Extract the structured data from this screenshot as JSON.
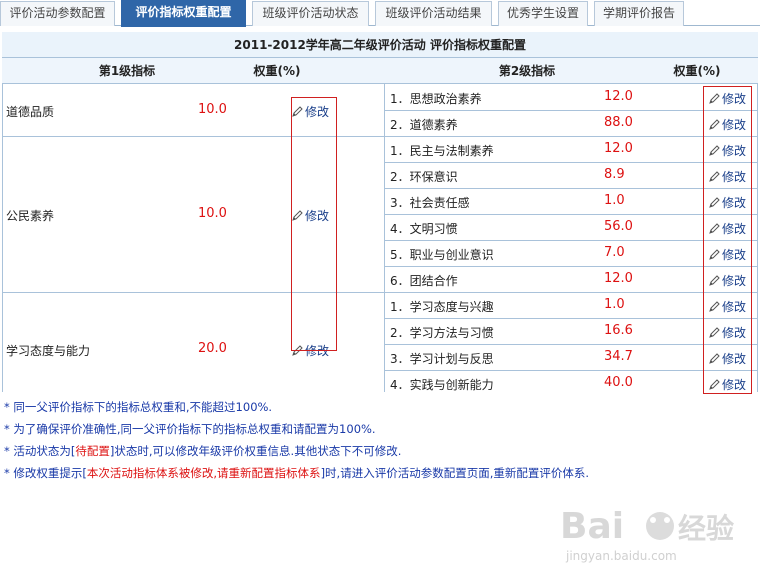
{
  "tabs": [
    {
      "label": "评价活动参数配置",
      "active": false
    },
    {
      "label": "评价指标权重配置",
      "active": true
    },
    {
      "label": "班级评价活动状态",
      "active": false
    },
    {
      "label": "班级评价活动结果",
      "active": false
    },
    {
      "label": "优秀学生设置",
      "active": false
    },
    {
      "label": "学期评价报告",
      "active": false
    }
  ],
  "table": {
    "title": "2011-2012学年高二年级评价活动 评价指标权重配置",
    "headers": {
      "level1": "第1级指标",
      "weight1": "权重(%)",
      "level2": "第2级指标",
      "weight2": "权重(%)"
    },
    "modify_label": "修改",
    "groups": [
      {
        "name": "道德品质",
        "weight": "10.0",
        "children": [
          {
            "name": "1．思想政治素养",
            "weight": "12.0"
          },
          {
            "name": "2．道德素养",
            "weight": "88.0"
          }
        ]
      },
      {
        "name": "公民素养",
        "weight": "10.0",
        "children": [
          {
            "name": "1．民主与法制素养",
            "weight": "12.0"
          },
          {
            "name": "2．环保意识",
            "weight": "8.9"
          },
          {
            "name": "3．社会责任感",
            "weight": "1.0"
          },
          {
            "name": "4．文明习惯",
            "weight": "56.0"
          },
          {
            "name": "5．职业与创业意识",
            "weight": "7.0"
          },
          {
            "name": "6．团结合作",
            "weight": "12.0"
          }
        ]
      },
      {
        "name": "学习态度与能力",
        "weight": "20.0",
        "children": [
          {
            "name": "1．学习态度与兴趣",
            "weight": "1.0"
          },
          {
            "name": "2．学习方法与习惯",
            "weight": "16.6"
          },
          {
            "name": "3．学习计划与反思",
            "weight": "34.7"
          },
          {
            "name": "4．实践与创新能力",
            "weight": "40.0"
          }
        ]
      }
    ]
  },
  "notes": [
    {
      "parts": [
        {
          "text": "* 同一父评价指标下的指标总权重和,不能超过100%.",
          "red": false
        }
      ]
    },
    {
      "parts": [
        {
          "text": "* 为了确保评价准确性,同一父评价指标下的指标总权重和请配置为100%.",
          "red": false
        }
      ]
    },
    {
      "parts": [
        {
          "text": "* 活动状态为[",
          "red": false
        },
        {
          "text": "待配置",
          "red": true
        },
        {
          "text": "]状态时,可以修改年级评价权重信息.其他状态下不可修改.",
          "red": false
        }
      ]
    },
    {
      "parts": [
        {
          "text": "* 修改权重提示[",
          "red": false
        },
        {
          "text": "本次活动指标体系被修改,请重新配置指标体系",
          "red": true
        },
        {
          "text": "]时,请进入评价活动参数配置页面,重新配置评价体系.",
          "red": false
        }
      ]
    }
  ],
  "watermark": {
    "brand": "Bai",
    "brand2": "经验",
    "url": "jingyan.baidu.com"
  },
  "colors": {
    "accent": "#2f66a8",
    "weight": "#dd1111",
    "link": "#1a3f8a",
    "highlight_box": "#d02020"
  }
}
